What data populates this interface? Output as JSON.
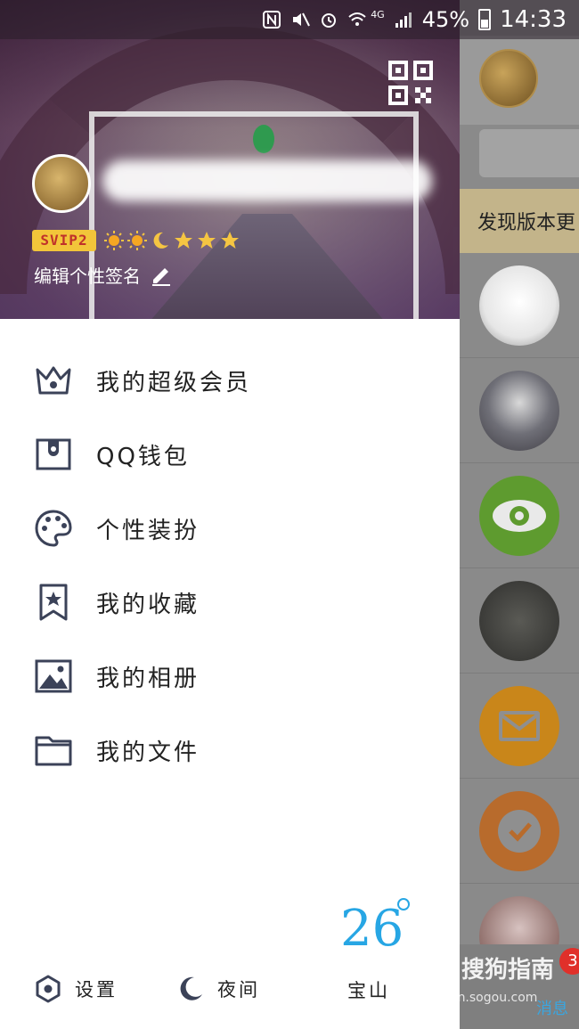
{
  "status_bar": {
    "battery_percent": "45%",
    "time": "14:33",
    "network": "4G"
  },
  "profile": {
    "svip_label": "SVIP2",
    "signature_label": "编辑个性签名",
    "level_icons": [
      "sun-icon",
      "sun-icon",
      "moon-icon",
      "star-icon",
      "star-icon",
      "star-icon"
    ]
  },
  "menu": {
    "items": [
      {
        "label": "我的超级会员",
        "icon": "crown-icon"
      },
      {
        "label": "QQ钱包",
        "icon": "wallet-icon"
      },
      {
        "label": "个性装扮",
        "icon": "palette-icon"
      },
      {
        "label": "我的收藏",
        "icon": "bookmark-star-icon"
      },
      {
        "label": "我的相册",
        "icon": "photo-icon"
      },
      {
        "label": "我的文件",
        "icon": "folder-icon"
      }
    ]
  },
  "weather": {
    "temperature": "26",
    "city": "宝山"
  },
  "bottom_bar": {
    "settings_label": "设置",
    "night_label": "夜间"
  },
  "right_panel": {
    "banner_text": "发现版本更",
    "messages_label": "消息",
    "badge_count": "3"
  },
  "watermark": {
    "text": "搜狗指南",
    "url": "zhinan.sogou.com"
  },
  "colors": {
    "accent": "#27a6e4",
    "icon": "#3b4258",
    "svip_bg": "#f2c53a",
    "svip_text": "#c0312a"
  }
}
